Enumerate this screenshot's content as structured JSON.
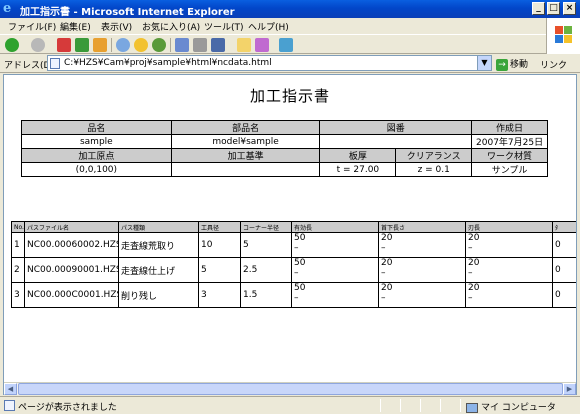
{
  "window": {
    "title": "加工指示書 - Microsoft Internet Explorer",
    "controls": {
      "minimize": "_",
      "maximize": "□",
      "close": "×"
    }
  },
  "menu": [
    "ファイル(F)",
    "編集(E)",
    "表示(V)",
    "お気に入り(A)",
    "ツール(T)",
    "ヘルプ(H)"
  ],
  "address": {
    "label": "アドレス(D)",
    "url": "C:¥HZS¥Cam¥proj¥sample¥html¥ncdata.html",
    "go": "移動",
    "links": "リンク"
  },
  "document": {
    "title": "加工指示書",
    "header_table": {
      "labels1": [
        "品名",
        "部品名",
        "図番",
        "作成日"
      ],
      "values1": [
        "sample",
        "model¥sample",
        "",
        "2007年7月25日"
      ],
      "labels2": [
        "加工原点",
        "加工基準",
        "板厚",
        "クリアランス",
        "ワーク材質"
      ],
      "values2": [
        "(0,0,100)",
        "",
        "t = 27.00",
        "z = 0.1",
        "サンプル"
      ]
    },
    "path_table": {
      "headers": [
        "No.",
        "パスファイル名",
        "パス種類",
        "工具径",
        "コーナー半径",
        "有効長",
        "首下長さ",
        "刃長",
        "ﾀ"
      ],
      "rows": [
        [
          "1",
          "NC00.00060002.HZS",
          "走査線荒取り",
          "10",
          "5",
          "50",
          "20",
          "20",
          "0"
        ],
        [
          "2",
          "NC00.00090001.HZS",
          "走査線仕上げ",
          "5",
          "2.5",
          "50",
          "20",
          "20",
          "0"
        ],
        [
          "3",
          "NC00.000C0001.HZS",
          "削り残し",
          "3",
          "1.5",
          "50",
          "20",
          "20",
          "0"
        ]
      ],
      "dash": "–"
    }
  },
  "status": {
    "text": "ページが表示されました",
    "zone": "マイ コンピュータ"
  },
  "colors": {
    "titlebar": "#0a5fe0",
    "header_cell": "#cccccc"
  }
}
